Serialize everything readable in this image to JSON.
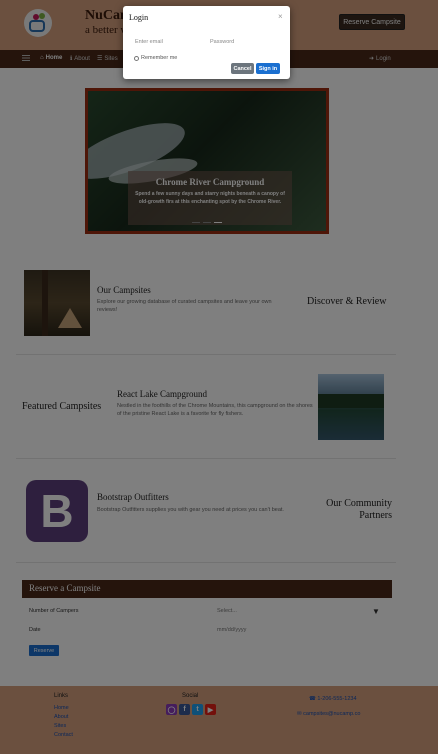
{
  "header": {
    "brand": "NuCamp",
    "tagline": "a better way to camp",
    "reserve_button": "Reserve Campsite"
  },
  "nav": {
    "home": "Home",
    "about": "About",
    "sites": "Sites",
    "login": "Login"
  },
  "carousel": {
    "title": "Chrome River Campground",
    "text": "Spend a few sunny days and starry nights beneath a canopy of old-growth firs at this enchanting spot by the Chrome River."
  },
  "sections": {
    "campsites": {
      "title": "Our Campsites",
      "text": "Explore our growing database of curated campsites and leave your own reviews!",
      "side": "Discover & Review"
    },
    "featured": {
      "side": "Featured Campsites",
      "title": "React Lake Campground",
      "text": "Nestled in the foothills of the Chrome Mountains, this campground on the shores of the pristine React Lake is a favorite for fly fishers."
    },
    "partners": {
      "title": "Bootstrap Outfitters",
      "text": "Bootstrap Outfitters supplies you with gear you need at prices you can't beat.",
      "side_line1": "Our Community",
      "side_line2": "Partners",
      "logo_letter": "B"
    }
  },
  "reserve_form": {
    "header": "Reserve a Campsite",
    "campers_label": "Number of Campers",
    "campers_value": "Select...",
    "date_label": "Date",
    "date_placeholder": "mm/dd/yyyy",
    "submit": "Reserve"
  },
  "footer": {
    "links_heading": "Links",
    "links": [
      "Home",
      "About",
      "Sites",
      "Contact"
    ],
    "social_heading": "Social",
    "phone": "1-206-555-1234",
    "email": "campsites@nucamp.co"
  },
  "modal": {
    "title": "Login",
    "close": "×",
    "email_placeholder": "Enter email",
    "password_placeholder": "Password",
    "remember": "Remember me",
    "cancel": "Cancel",
    "signin": "Sign in"
  },
  "colors": {
    "header_bg": "#d6a17f",
    "navbar_bg": "#4a2818",
    "primary_button": "#1a6fd0",
    "secondary_button": "#6c757d",
    "carousel_border": "#9c2d10"
  },
  "icons": {
    "nav_home": "home-icon",
    "nav_about": "info-icon",
    "nav_sites": "list-icon",
    "nav_login": "sign-in-icon",
    "footer_phone": "phone-icon",
    "footer_email": "envelope-icon",
    "social": [
      "instagram-icon",
      "facebook-icon",
      "twitter-icon",
      "youtube-icon"
    ]
  }
}
